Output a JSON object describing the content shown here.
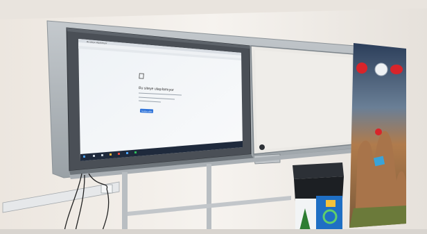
{
  "photo": {
    "screen": {
      "browser_tab_text": "Bu siteye ulaşılamıyor",
      "error_heading": "Bu siteye ulaşılamıyor",
      "reload_button_label": "Yeniden yükle"
    },
    "colors": {
      "wall": "#f1ede8",
      "whiteboard": "#eceae6",
      "screen_bg": "#f6f8fa",
      "taskbar": "#1f2a3c",
      "link_blue": "#2f73d9",
      "bin_dark": "#2c3036",
      "bin_blue": "#1f6fc4",
      "banner_dark": "#2c3e5a",
      "banner_rock": "#b07b4c",
      "flag_red": "#d8242a"
    }
  }
}
